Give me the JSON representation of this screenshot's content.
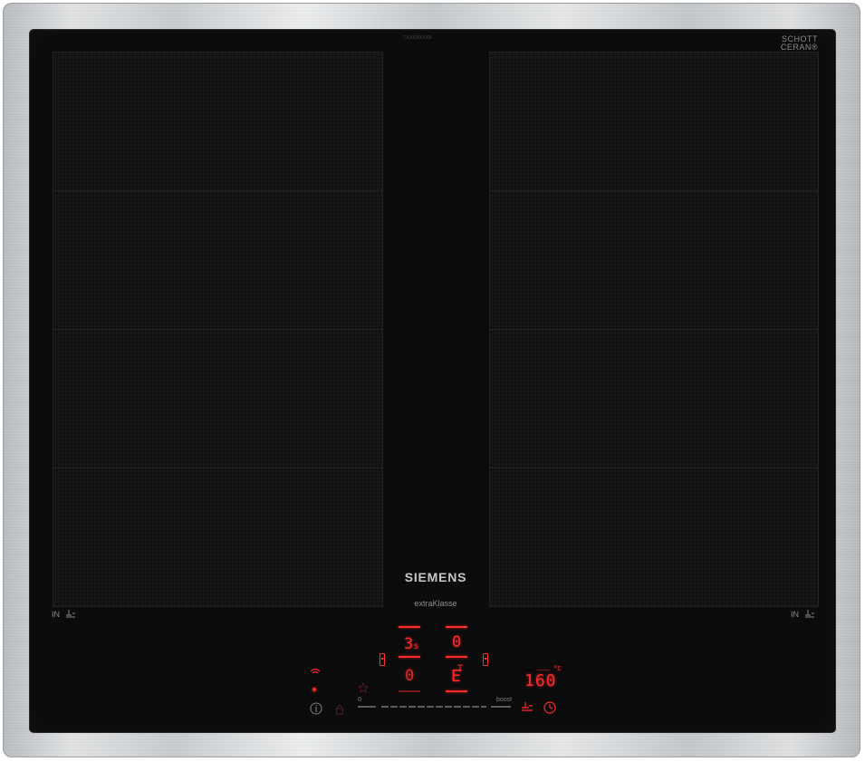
{
  "frame": {
    "material": "brushed-stainless-steel"
  },
  "glass": {
    "maker_line1": "SCHOTT",
    "maker_line2": "CERAN®",
    "top_microtext": "7XXXXXXXX"
  },
  "branding": {
    "brand": "SIEMENS",
    "series": "extraKlasse"
  },
  "zones": {
    "left_label": "IN",
    "right_label": "IN",
    "left_icon": "pot-icon",
    "right_icon": "pot-icon"
  },
  "controls": {
    "zone_power_top_left": "3",
    "zone_power_top_left_sub": "s",
    "zone_power_top_right": "0",
    "zone_power_bottom_left": "0",
    "zone_power_bottom_right": "E",
    "temperature_value": "160",
    "temperature_unit": "°C",
    "slider_min": "0",
    "slider_max": "boost",
    "icons": [
      "wifi-icon",
      "info-icon",
      "favorite-star-icon",
      "lock-icon",
      "frying-sensor-icon",
      "timer-icon",
      "zone-select-left-icon",
      "zone-select-right-icon"
    ]
  },
  "colors": {
    "display_red": "#ff2a2a",
    "glass": "#0b0b0c",
    "frame": "#d6d8da"
  }
}
